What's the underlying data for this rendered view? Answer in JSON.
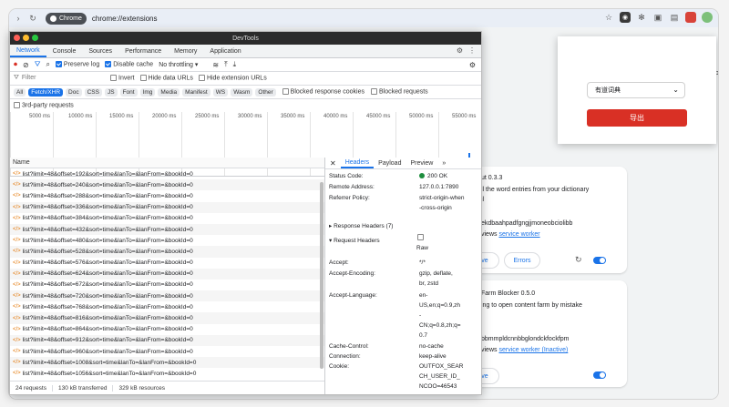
{
  "browser": {
    "profile_label": "Chrome",
    "url": "chrome://extensions"
  },
  "extensions_page": {
    "version1": "ut 0.3.3",
    "desc1a": "ll the word entries from your dictionary",
    "desc1b": "il",
    "id1": "ekdbaahpadfgngjjmoneobciolibb",
    "views1": "views",
    "sw1": "service worker",
    "remove_label": "ve",
    "errors_label": "Errors",
    "ext2_title": "Farm Blocker",
    "ext2_version": "0.5.0",
    "desc2": "ing to open content farm by mistake",
    "id2": "bbmmpldcnnbbglondckfockfpm",
    "views2": "views",
    "sw2": "service worker (Inactive)",
    "remove2_label": "ve",
    "side_text": "velop"
  },
  "popup": {
    "select_value": "有道词典",
    "export_label": "导出"
  },
  "devtools": {
    "title": "DevTools",
    "tabs": [
      "Network",
      "Console",
      "Sources",
      "Performance",
      "Memory",
      "Application"
    ],
    "preserve_log": "Preserve log",
    "disable_cache": "Disable cache",
    "throttling": "No throttling",
    "filter_placeholder": "Filter",
    "invert": "Invert",
    "hide_data_urls": "Hide data URLs",
    "hide_ext_urls": "Hide extension URLs",
    "filter_types": [
      "All",
      "Fetch/XHR",
      "Doc",
      "CSS",
      "JS",
      "Font",
      "Img",
      "Media",
      "Manifest",
      "WS",
      "Wasm",
      "Other"
    ],
    "blocked_cookies": "Blocked response cookies",
    "blocked_requests": "Blocked requests",
    "third_party": "3rd-party requests",
    "timeline_ticks": [
      "5000 ms",
      "10000 ms",
      "15000 ms",
      "20000 ms",
      "25000 ms",
      "30000 ms",
      "35000 ms",
      "40000 ms",
      "45000 ms",
      "50000 ms",
      "55000 ms"
    ],
    "name_header": "Name",
    "requests": [
      "list?limit=48&offset=192&sort=time&lanTo=&lanFrom=&bookId=0",
      "list?limit=48&offset=240&sort=time&lanTo=&lanFrom=&bookId=0",
      "list?limit=48&offset=288&sort=time&lanTo=&lanFrom=&bookId=0",
      "list?limit=48&offset=336&sort=time&lanTo=&lanFrom=&bookId=0",
      "list?limit=48&offset=384&sort=time&lanTo=&lanFrom=&bookId=0",
      "list?limit=48&offset=432&sort=time&lanTo=&lanFrom=&bookId=0",
      "list?limit=48&offset=480&sort=time&lanTo=&lanFrom=&bookId=0",
      "list?limit=48&offset=528&sort=time&lanTo=&lanFrom=&bookId=0",
      "list?limit=48&offset=576&sort=time&lanTo=&lanFrom=&bookId=0",
      "list?limit=48&offset=624&sort=time&lanTo=&lanFrom=&bookId=0",
      "list?limit=48&offset=672&sort=time&lanTo=&lanFrom=&bookId=0",
      "list?limit=48&offset=720&sort=time&lanTo=&lanFrom=&bookId=0",
      "list?limit=48&offset=768&sort=time&lanTo=&lanFrom=&bookId=0",
      "list?limit=48&offset=816&sort=time&lanTo=&lanFrom=&bookId=0",
      "list?limit=48&offset=864&sort=time&lanTo=&lanFrom=&bookId=0",
      "list?limit=48&offset=912&sort=time&lanTo=&lanFrom=&bookId=0",
      "list?limit=48&offset=960&sort=time&lanTo=&lanFrom=&bookId=0",
      "list?limit=48&offset=1008&sort=time&lanTo=&lanFrom=&bookId=0",
      "list?limit=48&offset=1056&sort=time&lanTo=&lanFrom=&bookId=0"
    ],
    "status_requests": "24 requests",
    "status_transferred": "130 kB transferred",
    "status_resources": "329 kB resources",
    "detail_tabs": [
      "Headers",
      "Payload",
      "Preview"
    ],
    "status_code_label": "Status Code:",
    "status_code_value": "200 OK",
    "remote_label": "Remote Address:",
    "remote_value": "127.0.0.1:7890",
    "referrer_label": "Referrer Policy:",
    "referrer_value_1": "strict-origin-when",
    "referrer_value_2": "-cross-origin",
    "response_headers": "Response Headers (7)",
    "request_headers": "Request Headers",
    "raw_label": "Raw",
    "accept_label": "Accept:",
    "accept_value": "*/*",
    "accept_enc_label": "Accept-Encoding:",
    "accept_enc_1": "gzip, deflate,",
    "accept_enc_2": "br, zstd",
    "accept_lang_label": "Accept-Language:",
    "accept_lang_1": "en-",
    "accept_lang_2": "US,en;q=0.9,zh",
    "accept_lang_3": "-",
    "accept_lang_4": "CN;q=0.8,zh;q=",
    "accept_lang_5": "0.7",
    "cache_label": "Cache-Control:",
    "cache_value": "no-cache",
    "conn_label": "Connection:",
    "conn_value": "keep-alive",
    "cookie_label": "Cookie:",
    "cookie_1": "OUTFOX_SEAR",
    "cookie_2": "CH_USER_ID_",
    "cookie_3": "NCOO=46543"
  },
  "colors": {
    "accent": "#1a73e8",
    "danger": "#d93025",
    "status_ok": "#1e8e3e"
  }
}
